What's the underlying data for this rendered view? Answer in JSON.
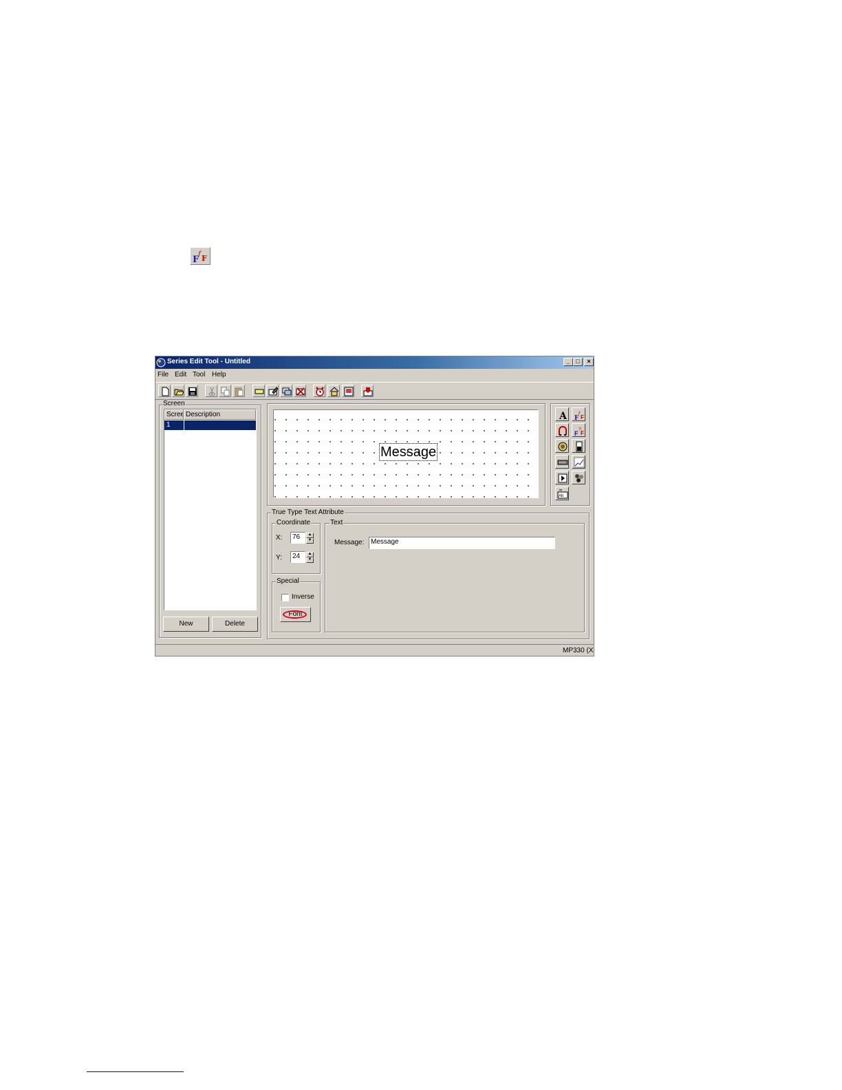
{
  "window": {
    "title": "Series Edit Tool - Untitled",
    "controls": {
      "minimize": "_",
      "maximize": "□",
      "close": "×"
    }
  },
  "menu": [
    "File",
    "Edit",
    "Tool",
    "Help"
  ],
  "toolbar_icons": [
    "new-file-icon",
    "open-folder-icon",
    "save-icon",
    "cut-icon",
    "copy-icon",
    "paste-icon",
    "add-screen-icon",
    "edit-screen-icon",
    "copy-screen-icon",
    "delete-screen-icon",
    "alarm-icon",
    "home-icon",
    "screen-icon",
    "download-icon"
  ],
  "screen_panel": {
    "label": "Screen",
    "columns": [
      "Screen",
      "Description"
    ],
    "rows": [
      {
        "screen": "1",
        "description": ""
      }
    ],
    "new_button": "New",
    "delete_button": "Delete"
  },
  "canvas": {
    "message": "Message"
  },
  "object_tools": [
    "text-icon",
    "truetype-text-icon",
    "bitmap-icon",
    "truetype-variable-icon",
    "lamp-icon",
    "bar-graph-icon",
    "keypad-icon",
    "trend-graph-icon",
    "play-icon",
    "animation-icon",
    "ascii-icon"
  ],
  "attributes": {
    "group_label": "True Type Text Attribute",
    "coordinate": {
      "label": "Coordinate",
      "x_label": "X:",
      "x_value": "76",
      "y_label": "Y:",
      "y_value": "24"
    },
    "special": {
      "label": "Special",
      "inverse_label": "Inverse",
      "inverse_checked": false,
      "font_button": "Font"
    },
    "text": {
      "label": "Text",
      "message_label": "Message:",
      "message_value": "Message"
    }
  },
  "status": {
    "right": "MP330 (X"
  },
  "colors": {
    "title_start": "#0a246a",
    "title_end": "#a6caf0",
    "selection": "#0a246a",
    "face": "#d4d0c8",
    "highlight_ring": "#e0001a"
  }
}
